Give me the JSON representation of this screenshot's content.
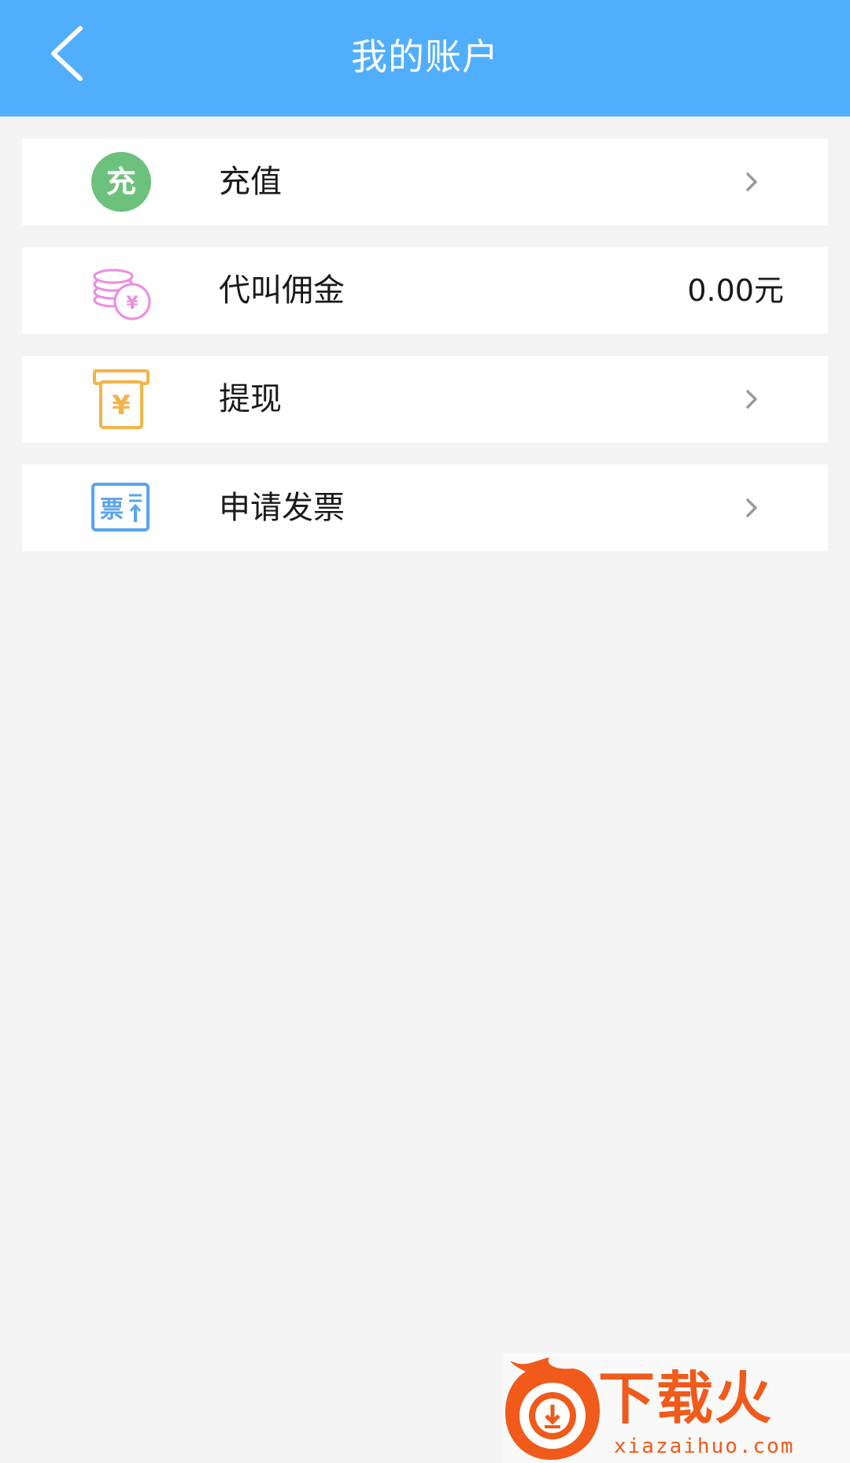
{
  "header": {
    "title": "我的账户",
    "background_color": "#51aefc",
    "back_icon": "chevron-left-icon"
  },
  "items": [
    {
      "key": "recharge",
      "label": "充值",
      "icon": "recharge-icon",
      "icon_text": "充",
      "icon_color": "#6cc27c",
      "trailing": "chevron-right-icon"
    },
    {
      "key": "commission",
      "label": "代叫佣金",
      "icon": "coins-icon",
      "icon_color": "#ee8be0",
      "value": "0.00元"
    },
    {
      "key": "withdraw",
      "label": "提现",
      "icon": "withdraw-icon",
      "icon_color": "#f3b44a",
      "trailing": "chevron-right-icon"
    },
    {
      "key": "invoice",
      "label": "申请发票",
      "icon": "invoice-icon",
      "icon_text": "票",
      "icon_color": "#5aa4ee",
      "trailing": "chevron-right-icon"
    }
  ],
  "watermark": {
    "brand": "下载火",
    "url": "xiazaihuo.com",
    "color": "#f05a1a"
  }
}
